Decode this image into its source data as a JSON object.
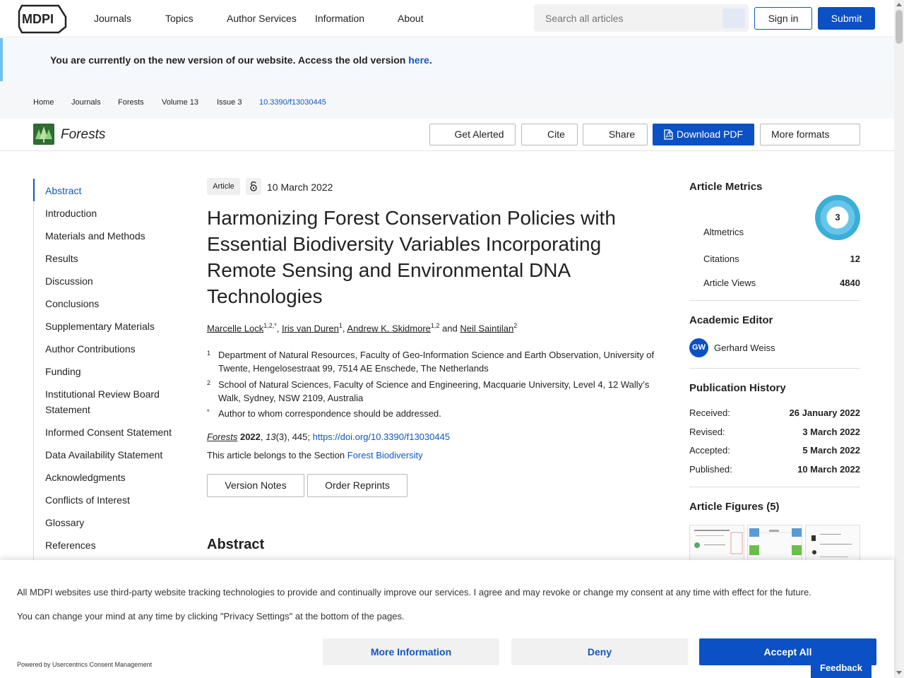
{
  "nav": {
    "logo": "MDPI",
    "links": [
      "Journals",
      "Topics",
      "Author Services",
      "Information",
      "About"
    ],
    "search_placeholder": "Search all articles",
    "signin": "Sign in",
    "submit": "Submit"
  },
  "banner": {
    "text": "You are currently on the new version of our website. Access the old version ",
    "link": "here",
    "end": "."
  },
  "breadcrumb": [
    "Home",
    "Journals",
    "Forests",
    "Volume 13",
    "Issue 3",
    "10.3390/f13030445"
  ],
  "journal": {
    "name": "Forests",
    "actions": {
      "alert": "Get Alerted",
      "cite": "Cite",
      "share": "Share",
      "download": "Download PDF",
      "more": "More formats"
    }
  },
  "toc": [
    "Abstract",
    "Introduction",
    "Materials and Methods",
    "Results",
    "Discussion",
    "Conclusions",
    "Supplementary Materials",
    "Author Contributions",
    "Funding",
    "Institutional Review Board Statement",
    "Informed Consent Statement",
    "Data Availability Statement",
    "Acknowledgments",
    "Conflicts of Interest",
    "Glossary",
    "References"
  ],
  "article": {
    "type": "Article",
    "date": "10 March 2022",
    "title": "Harmonizing Forest Conservation Policies with Essential Biodiversity Variables Incorporating Remote Sensing and Environmental DNA Technologies",
    "authors": [
      {
        "name": "Marcelle Lock",
        "sup": "1,2,*"
      },
      {
        "name": "Iris van Duren",
        "sup": "1"
      },
      {
        "name": "Andrew K. Skidmore",
        "sup": "1,2"
      },
      {
        "name": "Neil Saintilan",
        "sup": "2"
      }
    ],
    "and": "and",
    "affiliations": [
      {
        "num": "1",
        "text": "Department of Natural Resources, Faculty of Geo-Information Science and Earth Observation, University of Twente, Hengelosestraat 99, 7514 AE Enschede, The Netherlands"
      },
      {
        "num": "2",
        "text": "School of Natural Sciences, Faculty of Science and Engineering, Macquarie University, Level 4, 12 Wally’s Walk, Sydney, NSW 2109, Australia"
      },
      {
        "num": "*",
        "text": "Author to whom correspondence should be addressed."
      }
    ],
    "citation": {
      "journal": "Forests",
      "year": "2022",
      "volume": "13",
      "issue_pages": "(3), 445; ",
      "doi": "https://doi.org/10.3390/f13030445"
    },
    "section_prefix": "This article belongs to the Section ",
    "section": "Forest Biodiversity",
    "version_notes": "Version Notes",
    "order_reprints": "Order Reprints",
    "abstract_heading": "Abstract"
  },
  "metrics": {
    "heading": "Article Metrics",
    "altmetrics_label": "Altmetrics",
    "altmetrics_score": "3",
    "citations_label": "Citations",
    "citations": "12",
    "views_label": "Article Views",
    "views": "4840"
  },
  "editor": {
    "heading": "Academic Editor",
    "initials": "GW",
    "name": "Gerhard Weiss"
  },
  "history": {
    "heading": "Publication History",
    "rows": [
      {
        "label": "Received:",
        "date": "26 January 2022"
      },
      {
        "label": "Revised:",
        "date": "3 March 2022"
      },
      {
        "label": "Accepted:",
        "date": "5 March 2022"
      },
      {
        "label": "Published:",
        "date": "10 March 2022"
      }
    ]
  },
  "figures": {
    "heading": "Article Figures (5)"
  },
  "consent": {
    "text1": "All MDPI websites use third-party website tracking technologies to provide and continually improve our services. I agree and may revoke or change my consent at any time with effect for the future.",
    "text2": "You can change your mind at any time by clicking \"Privacy Settings\" at the bottom of the pages.",
    "more_info": "More Information",
    "deny": "Deny",
    "accept": "Accept All",
    "powered": "Powered by Usercentrics Consent Management"
  },
  "feedback": "Feedback",
  "colors": {
    "brand_blue": "#0b50c4",
    "link_blue": "#1157c1",
    "forests_green": "#2f6b33",
    "altmetric_ring": "#3aaed6"
  }
}
